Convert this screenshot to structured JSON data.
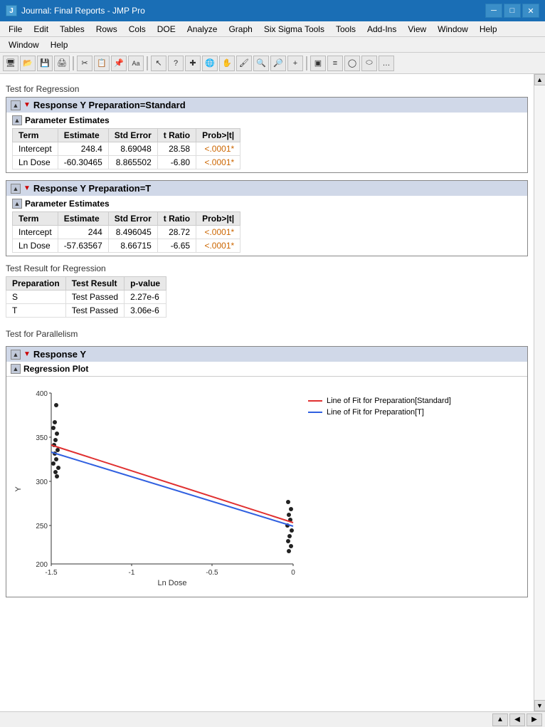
{
  "titleBar": {
    "icon": "J",
    "title": "Journal: Final Reports - JMP Pro",
    "minimize": "─",
    "maximize": "□",
    "close": "✕"
  },
  "menuBar": {
    "items": [
      "File",
      "Edit",
      "Tables",
      "Rows",
      "Cols",
      "DOE",
      "Analyze",
      "Graph",
      "Six Sigma Tools",
      "Tools",
      "Add-Ins",
      "View",
      "Window",
      "Help"
    ]
  },
  "topLabel": "Test for Regression",
  "responseStandard": {
    "title": "Response Y Preparation=Standard",
    "paramEstimates": {
      "label": "Parameter Estimates",
      "columns": [
        "Term",
        "Estimate",
        "Std Error",
        "t Ratio",
        "Prob>|t|"
      ],
      "rows": [
        {
          "term": "Intercept",
          "estimate": "248.4",
          "stdError": "8.69048",
          "tRatio": "28.58",
          "prob": "<.0001*"
        },
        {
          "term": "Ln Dose",
          "estimate": "-60.30465",
          "stdError": "8.865502",
          "tRatio": "-6.80",
          "prob": "<.0001*"
        }
      ]
    }
  },
  "responseT": {
    "title": "Response Y Preparation=T",
    "paramEstimates": {
      "label": "Parameter Estimates",
      "columns": [
        "Term",
        "Estimate",
        "Std Error",
        "t Ratio",
        "Prob>|t|"
      ],
      "rows": [
        {
          "term": "Intercept",
          "estimate": "244",
          "stdError": "8.496045",
          "tRatio": "28.72",
          "prob": "<.0001*"
        },
        {
          "term": "Ln Dose",
          "estimate": "-57.63567",
          "stdError": "8.66715",
          "tRatio": "-6.65",
          "prob": "<.0001*"
        }
      ]
    }
  },
  "testResultLabel": "Test Result for Regression",
  "testResultTable": {
    "columns": [
      "Preparation",
      "Test Result",
      "p-value"
    ],
    "rows": [
      {
        "prep": "S",
        "result": "Test Passed",
        "pvalue": "2.27e-6"
      },
      {
        "prep": "T",
        "result": "Test Passed",
        "pvalue": "3.06e-6"
      }
    ]
  },
  "parallelismLabel": "Test for Parallelism",
  "responseY": {
    "title": "Response Y",
    "regressionPlot": {
      "label": "Regression Plot",
      "yAxis": {
        "label": "Y",
        "min": 200,
        "max": 400,
        "ticks": [
          200,
          250,
          300,
          350,
          400
        ]
      },
      "xAxis": {
        "label": "Ln Dose",
        "min": -1.5,
        "max": 0,
        "ticks": [
          -1.5,
          -1,
          -0.5,
          0
        ]
      },
      "legend": {
        "standard": "Line of Fit for Preparation[Standard]",
        "t": "Line of Fit for Preparation[T]",
        "standardColor": "#e03030",
        "tColor": "#3060e0"
      }
    }
  },
  "statusBar": {
    "scrollUpBtn": "▲",
    "scrollDownBtn": "▼"
  }
}
